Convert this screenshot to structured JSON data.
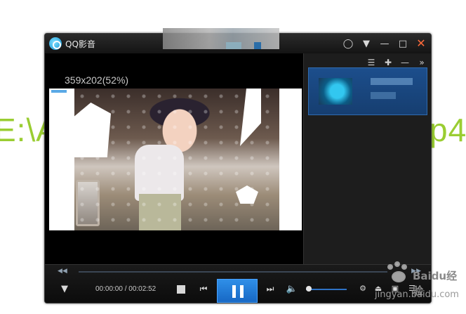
{
  "background": {
    "left_text": "E:\\A",
    "right_text": "p4"
  },
  "window": {
    "title": "QQ影音",
    "title_buttons": {
      "feedback": "feedback-icon",
      "menu": "dropdown-menu-icon",
      "minimize": "minimize-icon",
      "maximize": "maximize-icon",
      "close": "close-icon"
    }
  },
  "video": {
    "size_label": "359x202(52%)"
  },
  "playlist": {
    "tools": [
      "list-icon",
      "add-icon",
      "remove-icon",
      "expand-icon"
    ]
  },
  "controls": {
    "time": "00:00:00 / 00:02:52",
    "play_state": "paused",
    "volume_level": 0.05
  },
  "watermark": {
    "brand": "Baidu经验",
    "url": "jingyan.baidu.com"
  },
  "colors": {
    "accent": "#1f7fe0",
    "background_text": "#9acd32",
    "close": "#ff6a3a"
  }
}
